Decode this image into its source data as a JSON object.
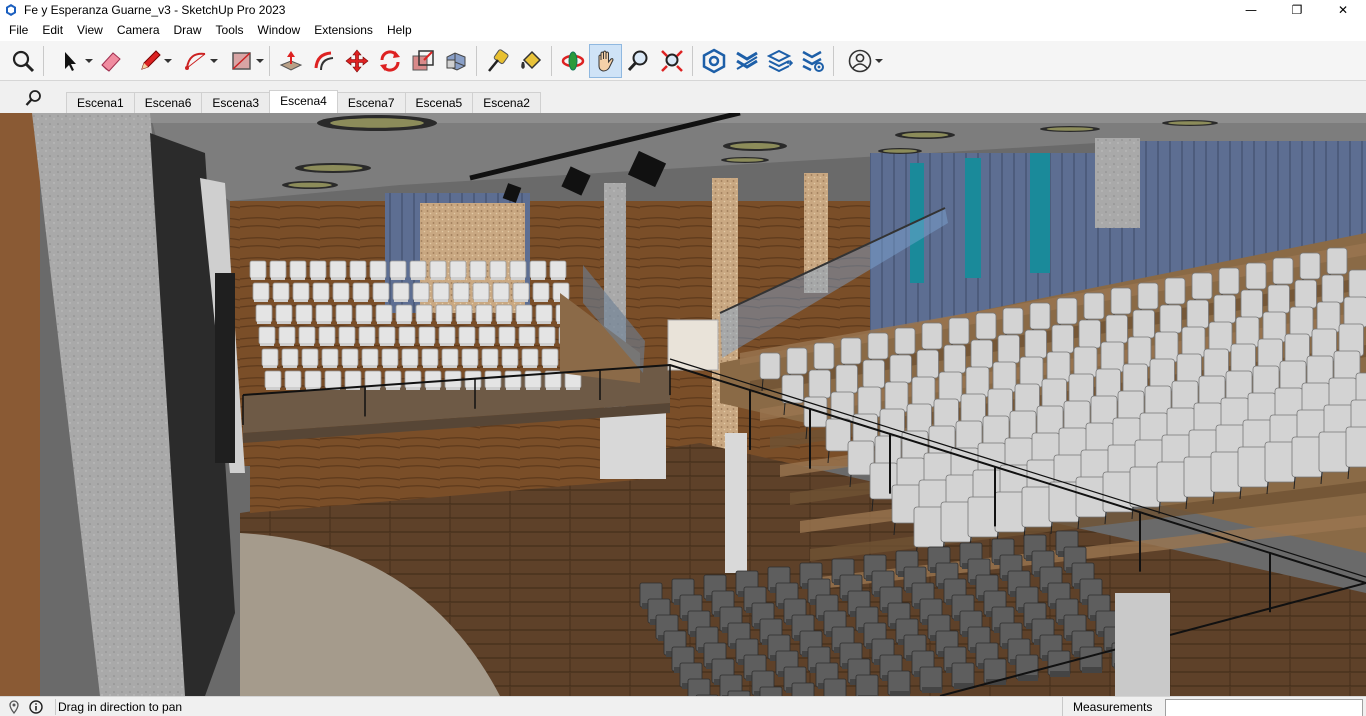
{
  "window": {
    "title": "Fe y Esperanza Guarne_v3 - SketchUp Pro 2023",
    "controls": {
      "minimize": "—",
      "maximize": "❐",
      "close": "✕"
    }
  },
  "menu": {
    "items": [
      "File",
      "Edit",
      "View",
      "Camera",
      "Draw",
      "Tools",
      "Window",
      "Extensions",
      "Help"
    ]
  },
  "toolbar": {
    "tools": [
      "search-icon",
      "select-icon",
      "eraser-icon",
      "pencil-icon",
      "arc-icon",
      "rectangle-icon",
      "push-pull-icon",
      "offset-icon",
      "move-icon",
      "rotate-icon",
      "scale-icon",
      "follow-me-icon",
      "tape-measure-icon",
      "paint-bucket-icon",
      "orbit-icon",
      "pan-icon",
      "zoom-icon",
      "zoom-extents-icon",
      "warehouse-icon",
      "extension-icon",
      "layers-icon",
      "extension-manager-icon",
      "account-icon"
    ],
    "active_tool": "pan-icon"
  },
  "scenes": {
    "tabs": [
      "Escena1",
      "Escena6",
      "Escena3",
      "Escena4",
      "Escena7",
      "Escena5",
      "Escena2"
    ],
    "active": "Escena4"
  },
  "status": {
    "message": "Drag in direction to pan",
    "measurements_label": "Measurements",
    "measurements_value": ""
  },
  "colors": {
    "accent_active": "#cfe3f7",
    "wood": "#8a5a2b",
    "chair": "#d9d9d9",
    "wall_blue": "#5a6f95"
  }
}
